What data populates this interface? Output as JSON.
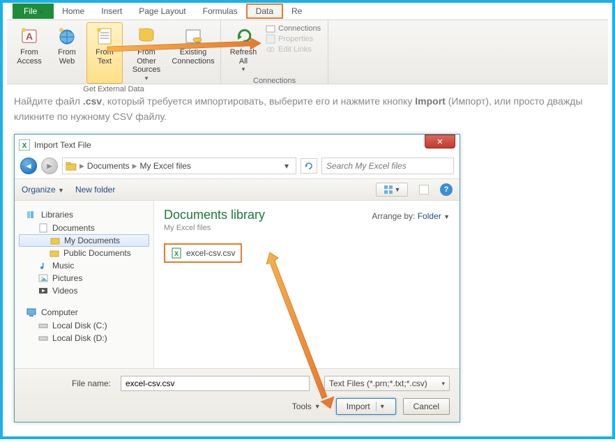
{
  "tabs": {
    "file": "File",
    "home": "Home",
    "insert": "Insert",
    "page_layout": "Page Layout",
    "formulas": "Formulas",
    "data": "Data",
    "review": "Re"
  },
  "ribbon": {
    "from_access": "From\nAccess",
    "from_web": "From\nWeb",
    "from_text": "From\nText",
    "from_other": "From Other\nSources",
    "existing": "Existing\nConnections",
    "refresh": "Refresh\nAll",
    "connections": "Connections",
    "properties": "Properties",
    "edit_links": "Edit Links",
    "group_get_external": "Get External Data",
    "group_connections": "Connections"
  },
  "para": {
    "t1": "Найдите файл ",
    "b1": ".csv",
    "t2": ", который требуется импортировать, выберите его и нажмите кнопку ",
    "b2": "Import",
    "t3": " (Импорт), или просто дважды кликните по нужному CSV файлу."
  },
  "dialog": {
    "title": "Import Text File",
    "breadcrumb": {
      "a": "Documents",
      "b": "My Excel files"
    },
    "search_placeholder": "Search My Excel files",
    "organize": "Organize",
    "new_folder": "New folder",
    "tree": {
      "libraries": "Libraries",
      "documents": "Documents",
      "my_documents": "My Documents",
      "public_documents": "Public Documents",
      "music": "Music",
      "pictures": "Pictures",
      "videos": "Videos",
      "computer": "Computer",
      "local_c": "Local Disk (C:)",
      "local_d": "Local Disk (D:)"
    },
    "content": {
      "title": "Documents library",
      "sub": "My Excel files",
      "arrange_label": "Arrange by:",
      "arrange_value": "Folder",
      "file": "excel-csv.csv"
    },
    "footer": {
      "file_name_label": "File name:",
      "file_name_value": "excel-csv.csv",
      "filter": "Text Files (*.prn;*.txt;*.csv)",
      "tools": "Tools",
      "import": "Import",
      "cancel": "Cancel"
    }
  }
}
